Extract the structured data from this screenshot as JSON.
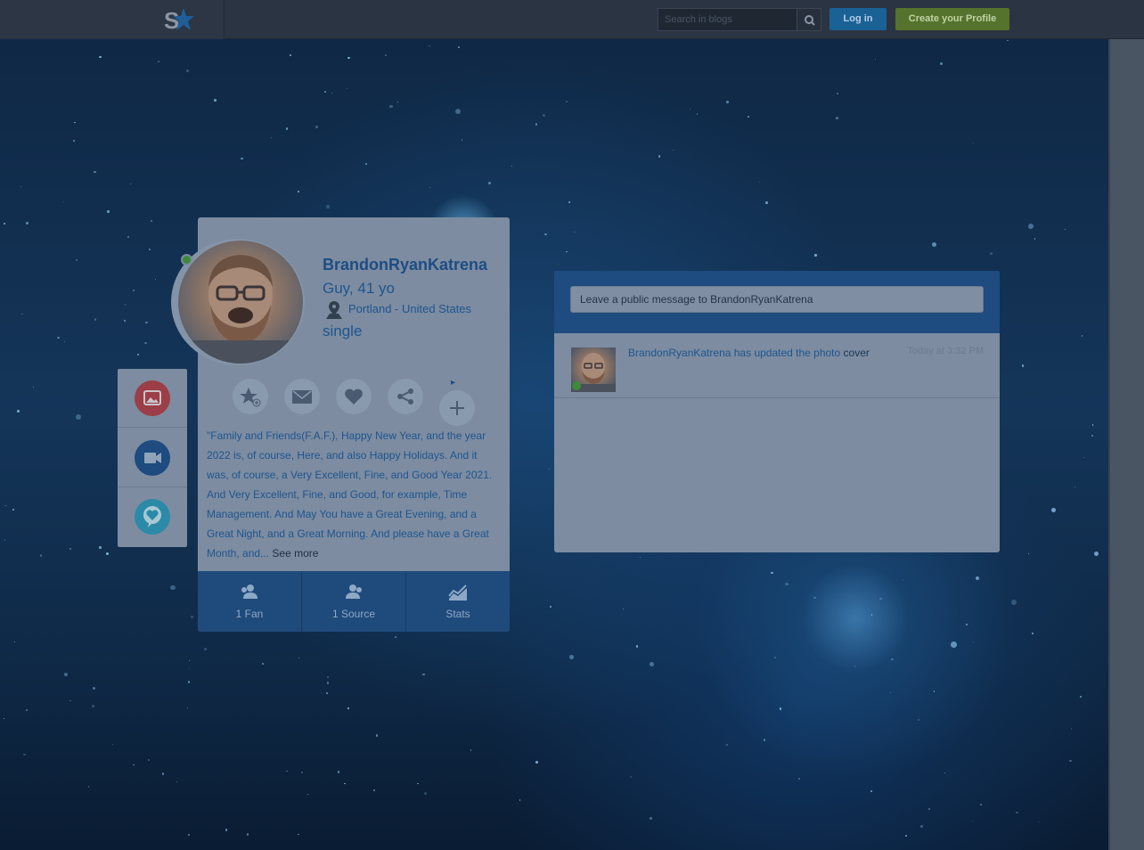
{
  "colors": {
    "page_overlay": "#0d1e35",
    "nav_bg": "#2a3442",
    "login_bg": "#1a6196",
    "create_bg": "#55732c",
    "card_bg": "#7d8ca0",
    "accent_blue": "#1e4b80",
    "online": "#3d8a3a"
  },
  "header": {
    "logo_icon": "site-star-logo",
    "search_placeholder": "Search in blogs",
    "search_icon": "search-icon",
    "login_label": "Log in",
    "create_profile_label": "Create your Profile"
  },
  "side_tools": [
    {
      "icon": "photo-icon",
      "color": "#9b3e48"
    },
    {
      "icon": "video-camera-icon",
      "color": "#1e4b80"
    },
    {
      "icon": "heart-chat-icon",
      "color": "#2b8aa8"
    }
  ],
  "profile": {
    "name": "BrandonRyanKatrena",
    "gender_age": "Guy, 41 yo",
    "location": "Portland - United States",
    "relationship": "single",
    "online": true,
    "actions": [
      {
        "icon": "star-add-icon"
      },
      {
        "icon": "envelope-icon"
      },
      {
        "icon": "heart-icon"
      },
      {
        "icon": "share-icon"
      },
      {
        "icon": "plus-icon"
      }
    ],
    "more_arrow": "▸",
    "bio_lines": [
      "\"Family and Friends(F.A.F.), Happy New Year, and the year",
      "2022 is, of course, Here, and also Happy Holidays. And it",
      "was, of course, a Very Excellent, Fine, and Good Year 2021.",
      "And Very Excellent, Fine, and Good, for example, Time",
      "Management. And May You have a Great Evening, and a",
      "Great Night, and a Great Morning. And please have a Great",
      "Month, and..."
    ],
    "see_more": "See more"
  },
  "stats": [
    {
      "icon": "fan-icon",
      "label": "1 Fan"
    },
    {
      "icon": "source-icon",
      "label": "1 Source"
    },
    {
      "icon": "stats-chart-icon",
      "label": "Stats"
    }
  ],
  "wall": {
    "message_placeholder": "Leave a public message to BrandonRyanKatrena",
    "feed": [
      {
        "user": "BrandonRyanKatrena",
        "action": " has updated the photo ",
        "object": "cover",
        "time": "Today at 3:32 PM"
      }
    ]
  }
}
